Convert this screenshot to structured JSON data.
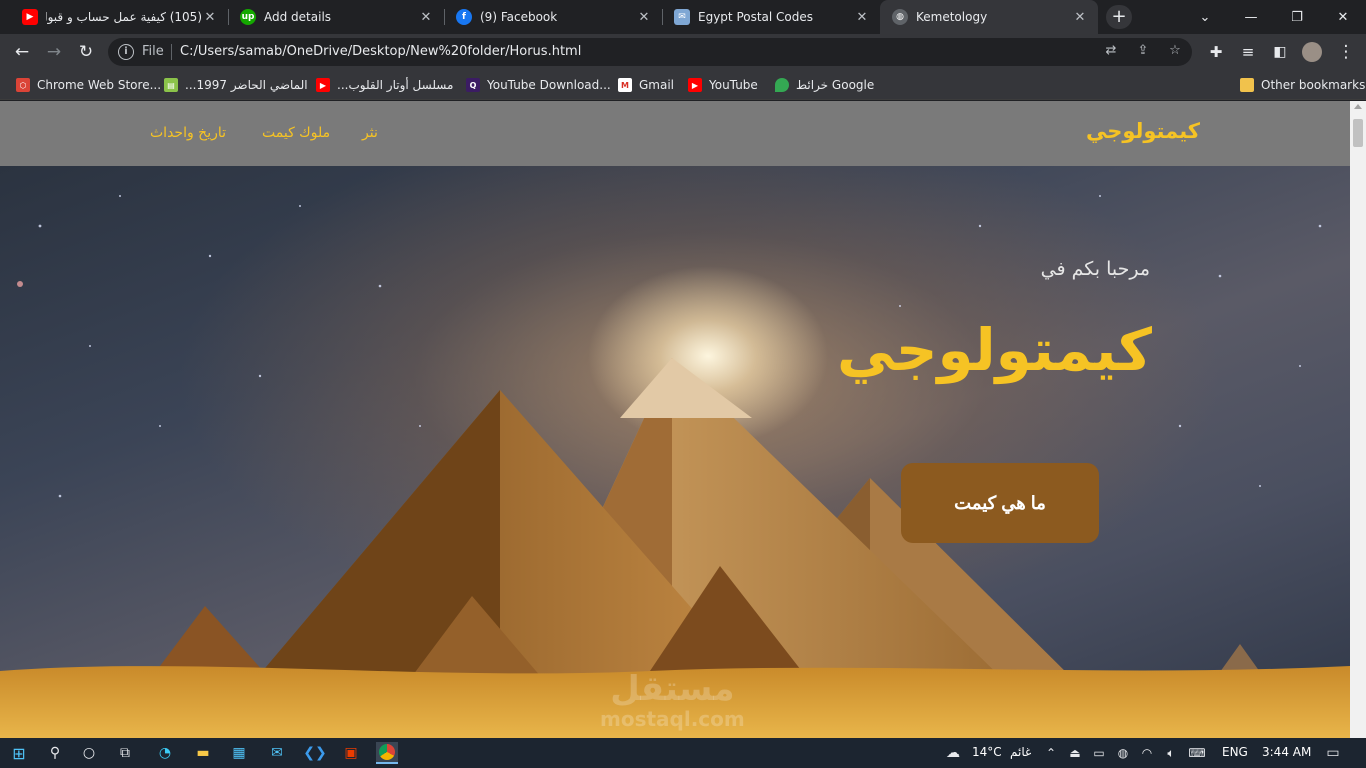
{
  "tabs": [
    {
      "title": "(105) كيفية عمل حساب و قبول",
      "favicon": "youtube-icon",
      "color": "#ff0000"
    },
    {
      "title": "Add details",
      "favicon": "upwork-icon",
      "color": "#14a800"
    },
    {
      "title": "(9) Facebook",
      "favicon": "facebook-icon",
      "color": "#1877f2"
    },
    {
      "title": "Egypt Postal Codes",
      "favicon": "postal-icon",
      "color": "#7fa7d4"
    },
    {
      "title": "Kemetology",
      "favicon": "globe-icon",
      "color": "#9aa0a6"
    }
  ],
  "toolbar": {
    "file_label": "File",
    "url": "C:/Users/samab/OneDrive/Desktop/New%20folder/Horus.html"
  },
  "bookmarks": [
    {
      "label": "Chrome Web Store...",
      "icon": "chrome-store-icon"
    },
    {
      "label": "الماضي الحاضر 1997...",
      "icon": "page-icon"
    },
    {
      "label": "مسلسل أوتار القلوب...",
      "icon": "youtube-icon"
    },
    {
      "label": "YouTube Download...",
      "icon": "q-icon"
    },
    {
      "label": "Gmail",
      "icon": "gmail-icon"
    },
    {
      "label": "YouTube",
      "icon": "youtube-icon"
    },
    {
      "label": "خرائط Google",
      "icon": "maps-icon"
    }
  ],
  "other_bookmarks": "Other bookmarks",
  "site": {
    "brand": "كيمتولوجي",
    "nav": [
      "تاريخ واحداث",
      "ملوك كيمت",
      "نثر"
    ],
    "welcome": "مرحبا بكم في",
    "title": "كيمتولوجي",
    "cta": "ما هي كيمت",
    "colors": {
      "accent": "#f6c324",
      "button": "#8c5a1f"
    }
  },
  "watermark": {
    "line1": "مستقل",
    "line2": "mostaql.com"
  },
  "taskbar": {
    "weather": "14°C",
    "weather_desc": "غائم",
    "lang": "ENG",
    "time": "3:44 AM"
  }
}
